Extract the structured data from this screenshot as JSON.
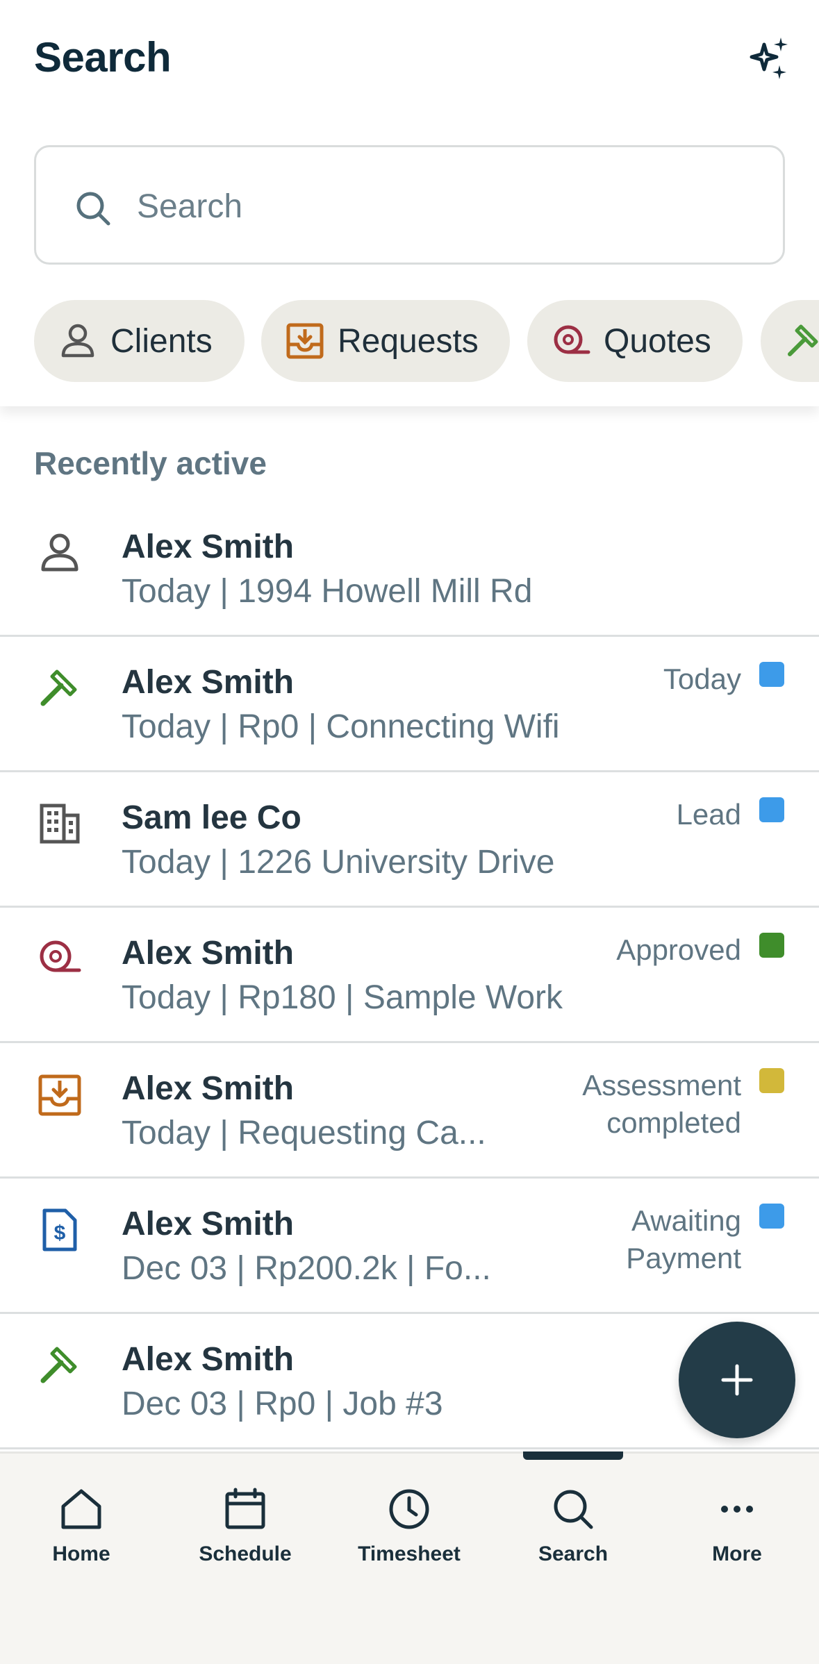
{
  "header": {
    "title": "Search",
    "sparkle_icon": "sparkles-icon"
  },
  "search": {
    "placeholder": "Search",
    "value": ""
  },
  "chips": [
    {
      "label": "Clients",
      "icon": "person-icon",
      "color": "#555555"
    },
    {
      "label": "Requests",
      "icon": "inbox-download-icon",
      "color": "#c06a1b"
    },
    {
      "label": "Quotes",
      "icon": "measuring-tape-icon",
      "color": "#9c2f44"
    },
    {
      "label": "",
      "icon": "hammer-icon",
      "color": "#4a9a3a"
    }
  ],
  "section": {
    "label": "Recently active"
  },
  "items": [
    {
      "icon": "person-icon",
      "name": "Alex Smith",
      "subtitle": "Today | 1994 Howell Mill Rd",
      "status": "",
      "status_color": ""
    },
    {
      "icon": "hammer-icon",
      "name": "Alex Smith",
      "subtitle": "Today | Rp0 | Connecting Wifi",
      "status": "Today",
      "status_color": "#3d9be9"
    },
    {
      "icon": "building-icon",
      "name": "Sam lee Co",
      "subtitle": "Today | 1226 University Drive",
      "status": "Lead",
      "status_color": "#3d9be9"
    },
    {
      "icon": "measuring-tape-icon",
      "name": "Alex Smith",
      "subtitle": "Today | Rp180 | Sample Work",
      "status": "Approved",
      "status_color": "#3f8d2b"
    },
    {
      "icon": "inbox-download-icon",
      "name": "Alex Smith",
      "subtitle": "Today | Requesting Ca...",
      "status_line1": "Assessment",
      "status_line2": "completed",
      "status_color": "#d2b83a"
    },
    {
      "icon": "invoice-dollar-icon",
      "name": "Alex Smith",
      "subtitle": "Dec 03 | Rp200.2k | Fo...",
      "status_line1": "Awaiting",
      "status_line2": "Payment",
      "status_color": "#3d9be9"
    },
    {
      "icon": "hammer-icon",
      "name": "Alex Smith",
      "subtitle": "Dec 03 | Rp0 | Job #3",
      "status": "",
      "status_color": ""
    }
  ],
  "fab": {
    "icon": "plus-icon"
  },
  "tabbar": {
    "active": "Search",
    "tabs": [
      {
        "label": "Home",
        "icon": "home-icon"
      },
      {
        "label": "Schedule",
        "icon": "calendar-icon"
      },
      {
        "label": "Timesheet",
        "icon": "clock-icon"
      },
      {
        "label": "Search",
        "icon": "search-icon"
      },
      {
        "label": "More",
        "icon": "more-dots-icon"
      }
    ]
  }
}
